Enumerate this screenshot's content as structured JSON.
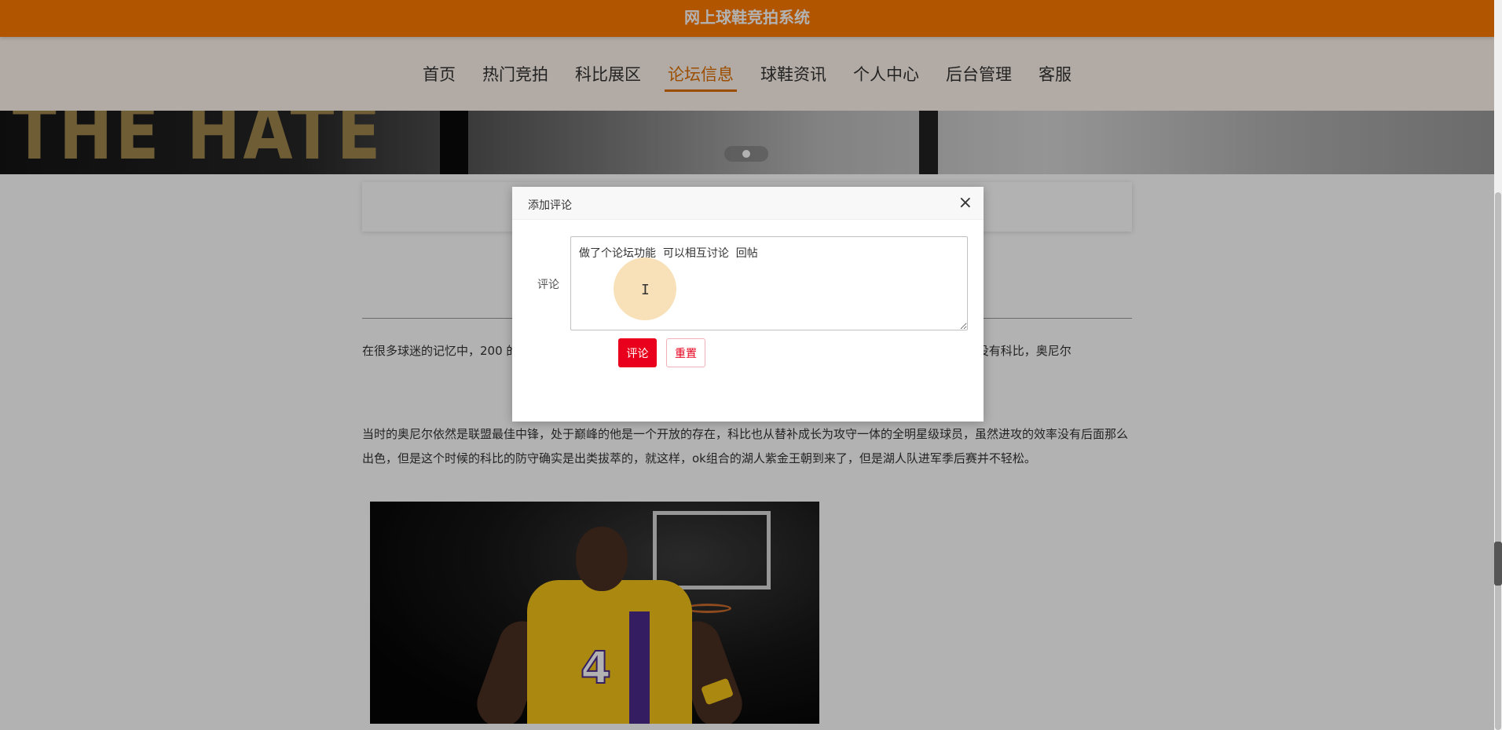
{
  "site": {
    "title": "网上球鞋竞拍系统"
  },
  "nav": {
    "items": [
      {
        "label": "首页"
      },
      {
        "label": "热门竞拍"
      },
      {
        "label": "科比展区"
      },
      {
        "label": "论坛信息",
        "active": true
      },
      {
        "label": "球鞋资讯"
      },
      {
        "label": "个人中心"
      },
      {
        "label": "后台管理"
      },
      {
        "label": "客服"
      }
    ],
    "accent_color": "#e07000"
  },
  "banner": {
    "text": "THE HATE"
  },
  "article": {
    "paragraph1": "在很多球迷的记忆中，200                                                                                                                                                       的第2号前锋，但是也有不少人评价说，布莱恩特为球                                                                                                                                 尔的福，布莱恩特没有多贡献，如果没有科比，奥尼尔",
    "paragraph2": "当时的奥尼尔依然是联盟最佳中锋，处于巅峰的他是一个开放的存在，科比也从替补成长为攻守一体的全明星级球员，虽然进攻的效率没有后面那么出色，但是这个时候的科比的防守确实是出类拔萃的，就这样，ok组合的湖人紫金王朝到来了，但是湖人队进军季后赛并不轻松。",
    "image_alt": "kobe-photo"
  },
  "dialog": {
    "title": "添加评论",
    "close": "×",
    "field_label": "评论",
    "comment_value": "做了个论坛功能  可以相互讨论  回帖",
    "submit_label": "评论",
    "reset_label": "重置"
  },
  "colors": {
    "topbar": "#ff7a00",
    "nav_bg": "#fff5ec",
    "submit": "#e8001c"
  }
}
